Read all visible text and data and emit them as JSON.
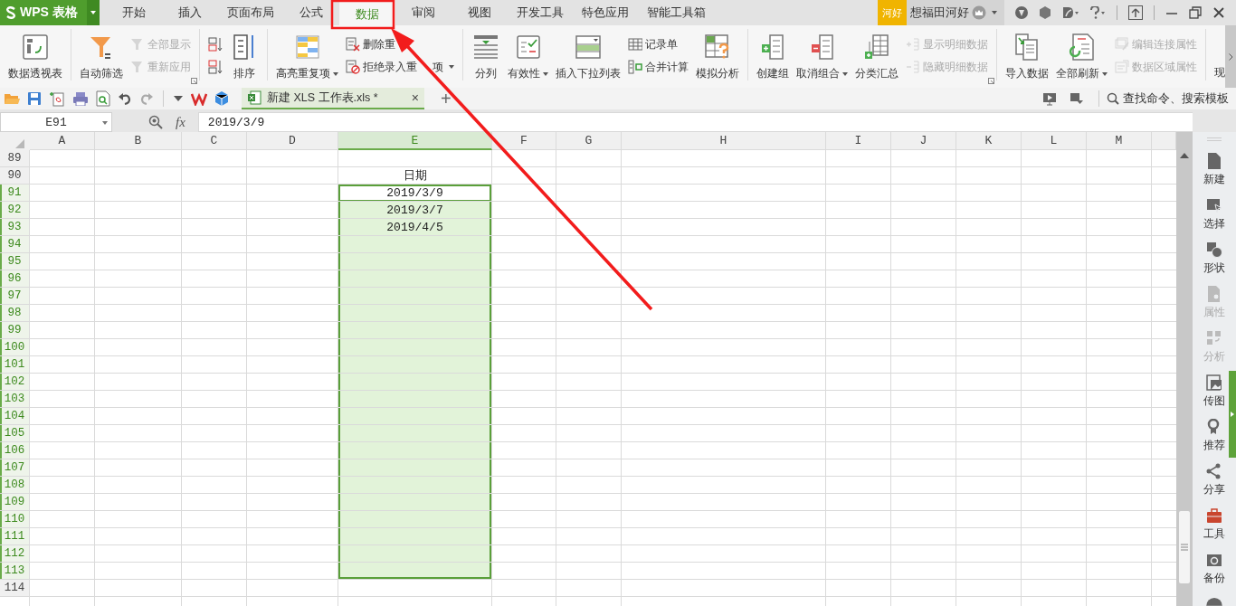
{
  "app": {
    "logo": "WPS 表格"
  },
  "tabs": [
    {
      "label": "开始",
      "selected": false
    },
    {
      "label": "插入",
      "selected": false
    },
    {
      "label": "页面布局",
      "selected": false
    },
    {
      "label": "公式",
      "selected": false
    },
    {
      "label": "数据",
      "selected": true
    },
    {
      "label": "审阅",
      "selected": false
    },
    {
      "label": "视图",
      "selected": false
    },
    {
      "label": "开发工具",
      "selected": false
    },
    {
      "label": "特色应用",
      "selected": false
    },
    {
      "label": "智能工具箱",
      "selected": false
    }
  ],
  "account": {
    "badge": "河好",
    "user": "想福田河好"
  },
  "ribbon": {
    "groups": [
      {
        "launcher": false,
        "items": [
          {
            "kind": "large",
            "label": "数据透视表",
            "disabled": false,
            "dropdown": false
          }
        ]
      },
      {
        "launcher": true,
        "items": [
          {
            "kind": "large",
            "label": "自动筛选",
            "disabled": false,
            "dropdown": false
          },
          {
            "kind": "stack",
            "items": [
              {
                "label": "全部显示",
                "disabled": true,
                "dropdown": false
              },
              {
                "label": "重新应用",
                "disabled": true,
                "dropdown": false
              }
            ]
          }
        ]
      },
      {
        "launcher": false,
        "items": [
          {
            "kind": "stack",
            "items": [
              {
                "disabled": false,
                "dropdown": false
              },
              {
                "disabled": false,
                "dropdown": false
              }
            ]
          },
          {
            "kind": "large",
            "label": "排序",
            "disabled": false,
            "dropdown": false
          }
        ]
      },
      {
        "launcher": false,
        "items": [
          {
            "kind": "large",
            "label": "高亮重复项",
            "disabled": false,
            "dropdown": true
          },
          {
            "kind": "stack",
            "items": [
              {
                "label": "删除重",
                "disabled": false,
                "dropdown": false
              },
              {
                "label": "拒绝录入重",
                "label_end": "项",
                "disabled": false,
                "dropdown": true
              }
            ]
          }
        ]
      },
      {
        "launcher": false,
        "items": [
          {
            "kind": "large",
            "label": "分列",
            "disabled": false,
            "dropdown": false
          },
          {
            "kind": "large",
            "label": "有效性",
            "disabled": false,
            "dropdown": true
          },
          {
            "kind": "large",
            "label": "插入下拉列表",
            "disabled": false,
            "dropdown": false
          },
          {
            "kind": "stack",
            "items": [
              {
                "label": "记录单",
                "disabled": false,
                "dropdown": false
              },
              {
                "label": "合并计算",
                "disabled": false,
                "dropdown": false
              }
            ]
          },
          {
            "kind": "large",
            "label": "模拟分析",
            "disabled": false,
            "dropdown": false
          }
        ]
      },
      {
        "launcher": true,
        "items": [
          {
            "kind": "large",
            "label": "创建组",
            "disabled": false,
            "dropdown": false
          },
          {
            "kind": "large",
            "label": "取消组合",
            "disabled": false,
            "dropdown": true
          },
          {
            "kind": "large",
            "label": "分类汇总",
            "disabled": false,
            "dropdown": false
          },
          {
            "kind": "stack",
            "items": [
              {
                "label": "显示明细数据",
                "disabled": true,
                "dropdown": false
              },
              {
                "label": "隐藏明细数据",
                "disabled": true,
                "dropdown": false
              }
            ]
          }
        ]
      },
      {
        "launcher": false,
        "items": [
          {
            "kind": "large",
            "label": "导入数据",
            "disabled": false,
            "dropdown": false
          },
          {
            "kind": "large",
            "label": "全部刷新",
            "disabled": false,
            "dropdown": true
          },
          {
            "kind": "stack",
            "items": [
              {
                "label": "编辑连接属性",
                "disabled": true,
                "dropdown": false
              },
              {
                "label": "数据区域属性",
                "disabled": true,
                "dropdown": false
              }
            ]
          }
        ]
      },
      {
        "launcher": false,
        "items": [
          {
            "kind": "large",
            "label": "现",
            "disabled": false,
            "dropdown": false
          }
        ]
      }
    ]
  },
  "document_tab": {
    "title": "新建 XLS 工作表.xls *",
    "close": "×",
    "add": "+"
  },
  "search": {
    "label": "查找命令、搜索模板"
  },
  "formula_bar": {
    "name_box": "E91",
    "fx": "fx",
    "value": "2019/3/9"
  },
  "columns": [
    {
      "label": "A",
      "selected": false
    },
    {
      "label": "B",
      "selected": false
    },
    {
      "label": "C",
      "selected": false
    },
    {
      "label": "D",
      "selected": false
    },
    {
      "label": "E",
      "selected": true
    },
    {
      "label": "F",
      "selected": false
    },
    {
      "label": "G",
      "selected": false
    },
    {
      "label": "H",
      "selected": false
    },
    {
      "label": "I",
      "selected": false
    },
    {
      "label": "J",
      "selected": false
    },
    {
      "label": "K",
      "selected": false
    },
    {
      "label": "L",
      "selected": false
    },
    {
      "label": "M",
      "selected": false
    }
  ],
  "rows": [
    {
      "label": "89",
      "selected": false,
      "active": false
    },
    {
      "label": "90",
      "selected": false,
      "active": false,
      "e": "日期"
    },
    {
      "label": "91",
      "selected": true,
      "active": true,
      "e": "2019/3/9"
    },
    {
      "label": "92",
      "selected": true,
      "active": false,
      "e": "2019/3/7"
    },
    {
      "label": "93",
      "selected": true,
      "active": false,
      "e": "2019/4/5"
    },
    {
      "label": "94",
      "selected": true,
      "active": false
    },
    {
      "label": "95",
      "selected": true,
      "active": false
    },
    {
      "label": "96",
      "selected": true,
      "active": false
    },
    {
      "label": "97",
      "selected": true,
      "active": false
    },
    {
      "label": "98",
      "selected": true,
      "active": false
    },
    {
      "label": "99",
      "selected": true,
      "active": false
    },
    {
      "label": "100",
      "selected": true,
      "active": false
    },
    {
      "label": "101",
      "selected": true,
      "active": false
    },
    {
      "label": "102",
      "selected": true,
      "active": false
    },
    {
      "label": "103",
      "selected": true,
      "active": false
    },
    {
      "label": "104",
      "selected": true,
      "active": false
    },
    {
      "label": "105",
      "selected": true,
      "active": false
    },
    {
      "label": "106",
      "selected": true,
      "active": false
    },
    {
      "label": "107",
      "selected": true,
      "active": false
    },
    {
      "label": "108",
      "selected": true,
      "active": false
    },
    {
      "label": "109",
      "selected": true,
      "active": false
    },
    {
      "label": "110",
      "selected": true,
      "active": false
    },
    {
      "label": "111",
      "selected": true,
      "active": false
    },
    {
      "label": "112",
      "selected": true,
      "active": false
    },
    {
      "label": "113",
      "selected": true,
      "active": false
    },
    {
      "label": "114",
      "selected": false,
      "active": false
    }
  ],
  "sidebar": [
    {
      "label": "新建",
      "disabled": false
    },
    {
      "label": "选择",
      "disabled": false
    },
    {
      "label": "形状",
      "disabled": false
    },
    {
      "label": "属性",
      "disabled": true
    },
    {
      "label": "分析",
      "disabled": true
    },
    {
      "label": "传图",
      "disabled": false
    },
    {
      "label": "推荐",
      "disabled": false
    },
    {
      "label": "分享",
      "disabled": false
    },
    {
      "label": "工具",
      "disabled": false
    },
    {
      "label": "备份",
      "disabled": false
    }
  ]
}
